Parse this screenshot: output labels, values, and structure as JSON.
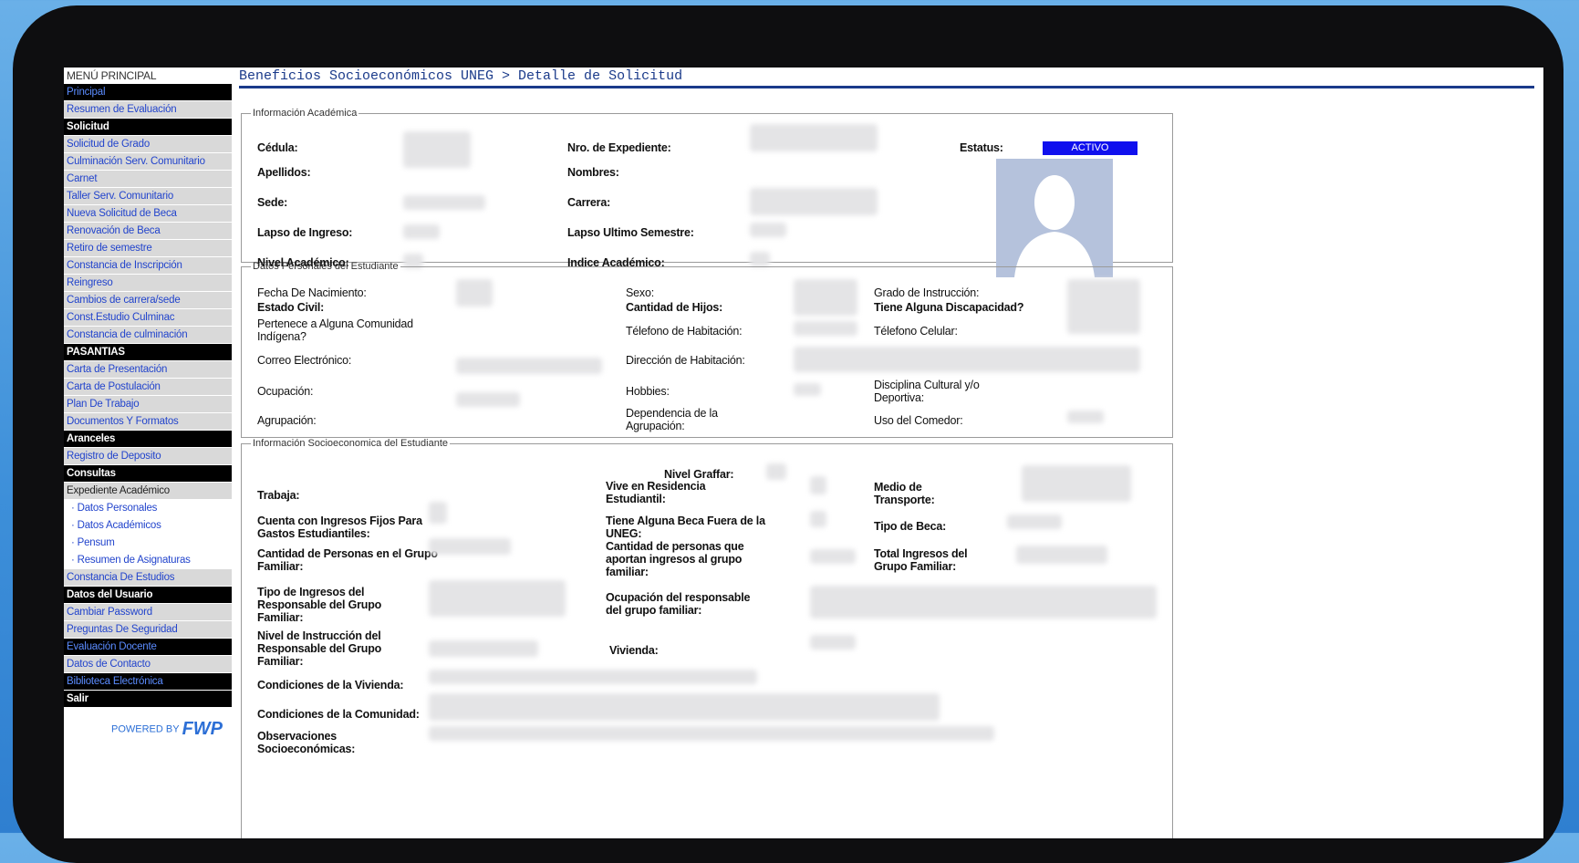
{
  "menu": {
    "title": "MENÚ PRINCIPAL",
    "items": [
      {
        "label": "Principal",
        "style": "hdr-blue"
      },
      {
        "label": "Resumen de Evaluación",
        "style": "blue"
      },
      {
        "label": "Solicitud",
        "style": "hdr"
      },
      {
        "label": "Solicitud de Grado",
        "style": "blue"
      },
      {
        "label": "Culminación Serv. Comunitario",
        "style": "blue"
      },
      {
        "label": "Carnet",
        "style": "blue"
      },
      {
        "label": "Taller Serv. Comunitario",
        "style": "blue"
      },
      {
        "label": "Nueva Solicitud de Beca",
        "style": "blue"
      },
      {
        "label": "Renovación de Beca",
        "style": "blue"
      },
      {
        "label": "Retiro de semestre",
        "style": "blue"
      },
      {
        "label": "Constancia de Inscripción",
        "style": "blue"
      },
      {
        "label": "Reingreso",
        "style": "blue"
      },
      {
        "label": "Cambios de carrera/sede",
        "style": "blue"
      },
      {
        "label": "Const.Estudio Culminac",
        "style": "blue"
      },
      {
        "label": "Constancia de culminación",
        "style": "blue"
      },
      {
        "label": "PASANTIAS",
        "style": "hdr"
      },
      {
        "label": "Carta de Presentación",
        "style": "blue"
      },
      {
        "label": "Carta de Postulación",
        "style": "blue"
      },
      {
        "label": "Plan De Trabajo",
        "style": "blue"
      },
      {
        "label": "Documentos Y Formatos",
        "style": "blue"
      },
      {
        "label": "Aranceles",
        "style": "hdr"
      },
      {
        "label": "Registro de Deposito",
        "style": "blue"
      },
      {
        "label": "Consultas",
        "style": "hdr"
      },
      {
        "label": "Expediente Académico",
        "style": "grey"
      },
      {
        "label": "· Datos Personales",
        "style": "sub"
      },
      {
        "label": "· Datos Académicos",
        "style": "sub"
      },
      {
        "label": "· Pensum",
        "style": "sub"
      },
      {
        "label": "· Resumen de Asignaturas",
        "style": "sub"
      },
      {
        "label": "Constancia De Estudios",
        "style": "blue"
      },
      {
        "label": "Datos del Usuario",
        "style": "hdr"
      },
      {
        "label": "Cambiar Password",
        "style": "blue"
      },
      {
        "label": "Preguntas De Seguridad",
        "style": "blue"
      },
      {
        "label": "Evaluación Docente",
        "style": "hdr-blue"
      },
      {
        "label": "Datos de Contacto",
        "style": "blue"
      },
      {
        "label": "Biblioteca Electrónica",
        "style": "hdr-blue"
      },
      {
        "label": "Salir",
        "style": "hdr"
      }
    ],
    "powered_by": "POWERED BY",
    "powered_logo": "FWP"
  },
  "header": {
    "breadcrumb": "Beneficios Socioeconómicos UNEG > Detalle de Solicitud"
  },
  "academic": {
    "legend": "Información Académica",
    "status_label": "Estatus:",
    "status_value": "ACTIVO",
    "labels": [
      "Cédula:",
      "Apellidos:",
      "Sede:",
      "Lapso de Ingreso:",
      "Nivel Académico:",
      "Nro. de Expediente:",
      "Nombres:",
      "Carrera:",
      "Lapso Ultimo Semestre:",
      "Indice Académico:"
    ]
  },
  "personal": {
    "legend": "Datos Personales del Estudiante",
    "labels": [
      "Fecha De Nacimiento:",
      "Estado Civil:",
      "Pertenece a Alguna Comunidad Indígena?",
      "Correo Electrónico:",
      "Ocupación:",
      "Agrupación:",
      "Sexo:",
      "Cantidad de Hijos:",
      "Télefono de Habitación:",
      "Dirección de Habitación:",
      "Hobbies:",
      "Dependencia de la Agrupación:",
      "Grado de Instrucción:",
      "Tiene Alguna Discapacidad?",
      "Télefono Celular:",
      "Disciplina Cultural y/o Deportiva:",
      "Uso del Comedor:"
    ]
  },
  "socio": {
    "legend": "Información Socioeconomica del Estudiante",
    "labels": [
      "Nivel Graffar:",
      "Trabaja:",
      "Vive en Residencia Estudiantil:",
      "Medio de Transporte:",
      "Cuenta con Ingresos Fijos Para Gastos Estudiantiles:",
      "Tiene Alguna Beca Fuera de la UNEG:",
      "Tipo de Beca:",
      "Cantidad de Personas en el Grupo Familiar:",
      "Cantidad de personas que aportan ingresos al grupo familiar:",
      "Total Ingresos del Grupo Familiar:",
      "Tipo de Ingresos del Responsable del Grupo Familiar:",
      "Ocupación del responsable del grupo familiar:",
      "Nivel de Instrucción del Responsable del Grupo Familiar:",
      "Vivienda:",
      "Condiciones de la Vivienda:",
      "Condiciones de la Comunidad:",
      "Observaciones Socioeconómicas:"
    ]
  }
}
